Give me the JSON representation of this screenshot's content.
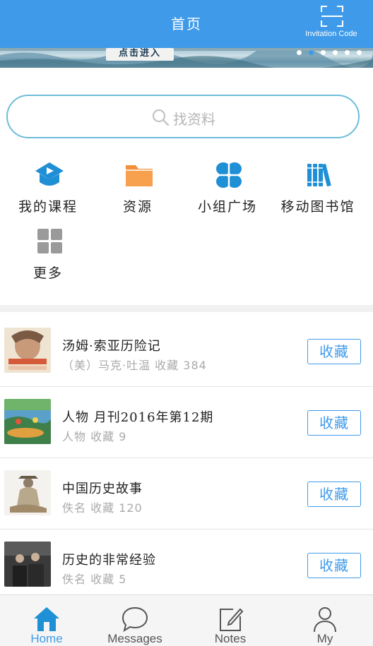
{
  "header": {
    "title": "首页",
    "invite_label": "Invitation Code"
  },
  "banner": {
    "button_text": "点击进入",
    "dot_count": 6,
    "active_dot": 1
  },
  "search": {
    "placeholder": "找资料"
  },
  "grid": [
    {
      "label": "我的课程",
      "icon": "course-play-icon"
    },
    {
      "label": "资源",
      "icon": "folder-icon"
    },
    {
      "label": "小组广场",
      "icon": "group-clover-icon"
    },
    {
      "label": "移动图书馆",
      "icon": "library-books-icon"
    },
    {
      "label": "更多",
      "icon": "more-grid-icon"
    }
  ],
  "list": [
    {
      "title": "汤姆·索亚历险记",
      "meta": "（美）马克·吐温  收藏 384",
      "button": "收藏"
    },
    {
      "title": "人物 月刊2016年第12期",
      "meta": "人物  收藏 9",
      "button": "收藏"
    },
    {
      "title": "中国历史故事",
      "meta": "佚名  收藏 120",
      "button": "收藏"
    },
    {
      "title": "历史的非常经验",
      "meta": "佚名  收藏 5",
      "button": "收藏"
    }
  ],
  "tabs": [
    {
      "label": "Home",
      "icon": "home-icon",
      "active": true
    },
    {
      "label": "Messages",
      "icon": "chat-bubble-icon",
      "active": false
    },
    {
      "label": "Notes",
      "icon": "note-edit-icon",
      "active": false
    },
    {
      "label": "My",
      "icon": "person-icon",
      "active": false
    }
  ],
  "colors": {
    "primary": "#3f9be9",
    "search_border": "#6cbddc",
    "folder": "#f58f3a",
    "more": "#9a9a9a"
  }
}
